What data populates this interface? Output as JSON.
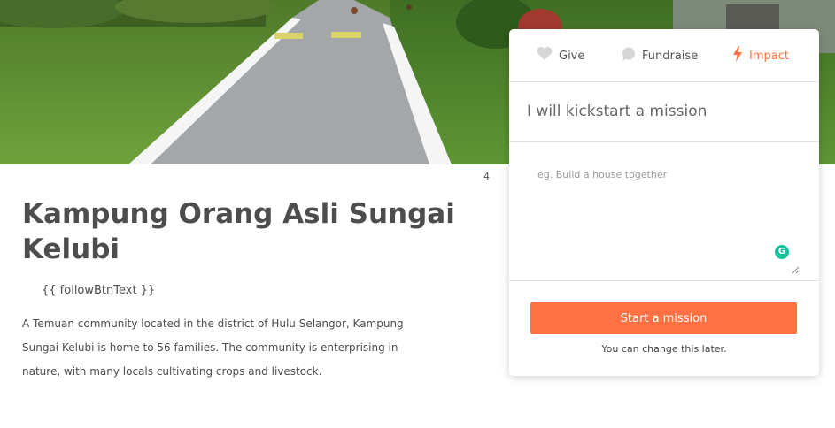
{
  "hero": {
    "image": "rural-road-photo"
  },
  "page_number": "4",
  "community": {
    "title": "Kampung Orang Asli Sungai Kelubi",
    "follow_label": "{{ followBtnText }}",
    "description": "A Temuan community located in the district of Hulu Selangor, Kampung Sungai Kelubi is home to 56 families. The community is enterprising in nature, with many locals cultivating crops and livestock."
  },
  "card": {
    "tabs": [
      {
        "label": "Give",
        "icon": "heart-icon",
        "active": false
      },
      {
        "label": "Fundraise",
        "icon": "speech-bubble-icon",
        "active": false
      },
      {
        "label": "Impact",
        "icon": "lightning-icon",
        "active": true
      }
    ],
    "statement": "I will kickstart a mission",
    "mission_placeholder": "eg. Build a house together",
    "start_button": "Start a mission",
    "hint": "You can change this later."
  },
  "colors": {
    "accent": "#ff7043",
    "grammarly": "#15c39a"
  }
}
